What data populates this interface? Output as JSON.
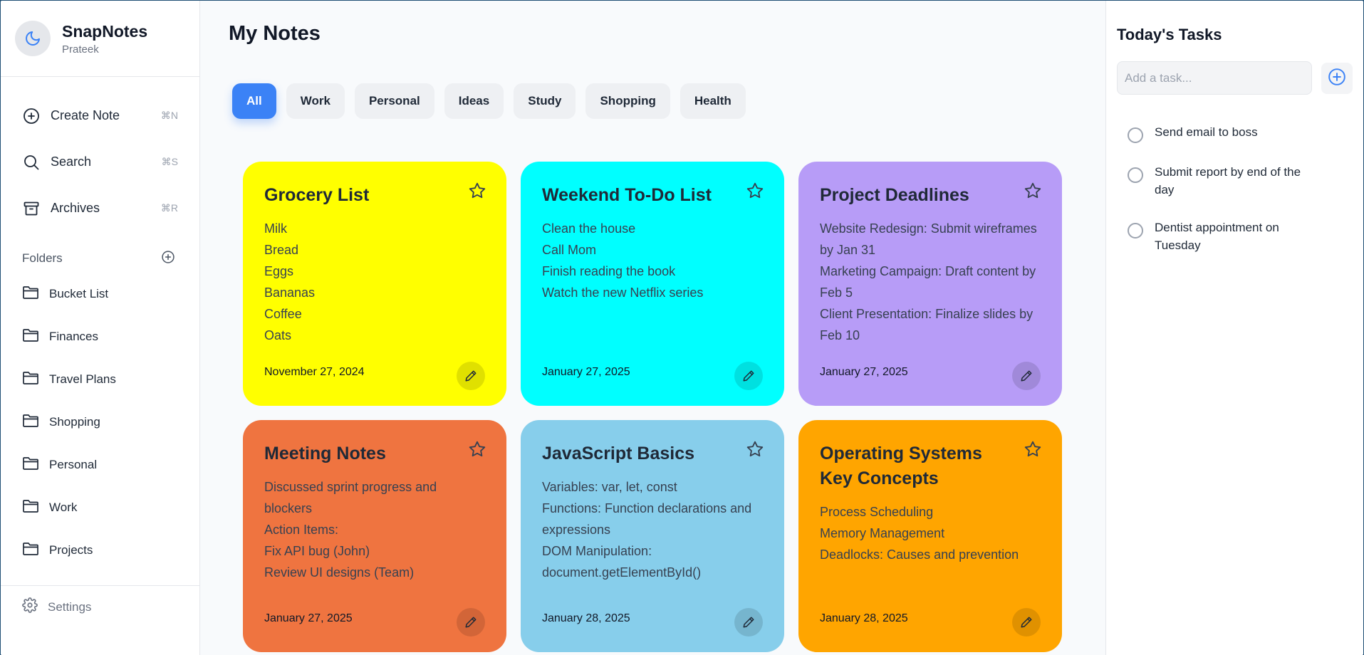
{
  "app": {
    "name": "SnapNotes",
    "user": "Prateek"
  },
  "nav": [
    {
      "label": "Create Note",
      "shortcut": "⌘N",
      "icon": "plus-circle-icon"
    },
    {
      "label": "Search",
      "shortcut": "⌘S",
      "icon": "search-icon"
    },
    {
      "label": "Archives",
      "shortcut": "⌘R",
      "icon": "archive-icon"
    }
  ],
  "folders": {
    "title": "Folders",
    "items": [
      "Bucket List",
      "Finances",
      "Travel Plans",
      "Shopping",
      "Personal",
      "Work",
      "Projects"
    ]
  },
  "settings_label": "Settings",
  "main": {
    "title": "My Notes",
    "filters": [
      "All",
      "Work",
      "Personal",
      "Ideas",
      "Study",
      "Shopping",
      "Health"
    ],
    "active_filter": "All"
  },
  "notes": [
    {
      "title": "Grocery List",
      "color": "#ffff00",
      "lines": [
        "Milk",
        "Bread",
        "Eggs",
        "Bananas",
        "Coffee",
        "Oats"
      ],
      "date": "November 27, 2024"
    },
    {
      "title": "Weekend To-Do List",
      "color": "#00ffff",
      "lines": [
        "Clean the house",
        "Call Mom",
        "Finish reading the book",
        "Watch the new Netflix series"
      ],
      "date": "January 27, 2025"
    },
    {
      "title": "Project Deadlines",
      "color": "#b79cf7",
      "lines": [
        "Website Redesign: Submit wireframes by Jan 31",
        "Marketing Campaign: Draft content by Feb 5",
        "Client Presentation: Finalize slides by Feb 10"
      ],
      "date": "January 27, 2025"
    },
    {
      "title": "Meeting Notes",
      "color": "#ef7440",
      "lines": [
        "Discussed sprint progress and blockers",
        "Action Items:",
        "Fix API bug (John)",
        "Review UI designs (Team)"
      ],
      "date": "January 27, 2025"
    },
    {
      "title": "JavaScript Basics",
      "color": "#87ceeb",
      "lines": [
        "Variables: var, let, const",
        "Functions: Function declarations and expressions",
        "DOM Manipulation: document.getElementById()"
      ],
      "date": "January 28, 2025"
    },
    {
      "title": "Operating Systems Key Concepts",
      "color": "#ffa500",
      "lines": [
        "Process Scheduling",
        "Memory Management",
        "Deadlocks: Causes and prevention"
      ],
      "date": "January 28, 2025"
    }
  ],
  "tasks": {
    "title": "Today's Tasks",
    "placeholder": "Add a task...",
    "items": [
      "Send email to boss",
      "Submit report by end of the day",
      "Dentist appointment on Tuesday"
    ]
  },
  "colors": {
    "accent": "#3b82f6"
  }
}
